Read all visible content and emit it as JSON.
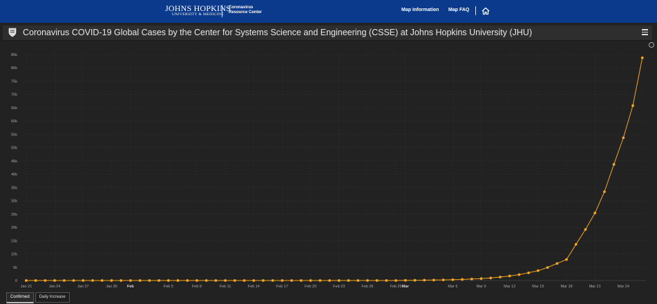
{
  "header": {
    "brand_name": "JOHNS HOPKINS",
    "brand_sub": "UNIVERSITY & MEDICINE",
    "resource_line1": "Coronavirus",
    "resource_line2": "Resource Center",
    "nav": [
      {
        "label": "Map Information"
      },
      {
        "label": "Map FAQ"
      }
    ]
  },
  "titlebar": {
    "title": "Coronavirus COVID-19 Global Cases by the Center for Systems Science and Engineering (CSSE) at Johns Hopkins University (JHU)"
  },
  "tabs": [
    {
      "label": "Confirmed",
      "active": true
    },
    {
      "label": "Daily Increase",
      "active": false
    }
  ],
  "colors": {
    "header_bg": "#0b3a8c",
    "chart_bg": "#222222",
    "series": "#f5a623"
  },
  "chart_data": {
    "type": "line",
    "title": "",
    "xlabel": "",
    "ylabel": "",
    "ylim": [
      0,
      85000
    ],
    "y_ticks": [
      "0",
      "5k",
      "10k",
      "15k",
      "20k",
      "25k",
      "30k",
      "35k",
      "40k",
      "45k",
      "50k",
      "55k",
      "60k",
      "65k",
      "70k",
      "75k",
      "80k",
      "85k"
    ],
    "y_tick_values": [
      0,
      5000,
      10000,
      15000,
      20000,
      25000,
      30000,
      35000,
      40000,
      45000,
      50000,
      55000,
      60000,
      65000,
      70000,
      75000,
      80000,
      85000
    ],
    "x_ticks": [
      {
        "label": "Jan 21",
        "index": 0,
        "bold": false
      },
      {
        "label": "Jan 24",
        "index": 3,
        "bold": false
      },
      {
        "label": "Jan 27",
        "index": 6,
        "bold": false
      },
      {
        "label": "Jan 30",
        "index": 9,
        "bold": false
      },
      {
        "label": "Feb",
        "index": 11,
        "bold": true
      },
      {
        "label": "Feb 5",
        "index": 15,
        "bold": false
      },
      {
        "label": "Feb 8",
        "index": 18,
        "bold": false
      },
      {
        "label": "Feb 11",
        "index": 21,
        "bold": false
      },
      {
        "label": "Feb 14",
        "index": 24,
        "bold": false
      },
      {
        "label": "Feb 17",
        "index": 27,
        "bold": false
      },
      {
        "label": "Feb 20",
        "index": 30,
        "bold": false
      },
      {
        "label": "Feb 23",
        "index": 33,
        "bold": false
      },
      {
        "label": "Feb 26",
        "index": 36,
        "bold": false
      },
      {
        "label": "Feb 29",
        "index": 39,
        "bold": false
      },
      {
        "label": "Mar",
        "index": 40,
        "bold": true
      },
      {
        "label": "Mar 6",
        "index": 45,
        "bold": false
      },
      {
        "label": "Mar 9",
        "index": 48,
        "bold": false
      },
      {
        "label": "Mar 12",
        "index": 51,
        "bold": false
      },
      {
        "label": "Mar 15",
        "index": 54,
        "bold": false
      },
      {
        "label": "Mar 18",
        "index": 57,
        "bold": false
      },
      {
        "label": "Mar 21",
        "index": 60,
        "bold": false
      },
      {
        "label": "Mar 24",
        "index": 63,
        "bold": false
      }
    ],
    "x_start": "Jan 21",
    "series": [
      {
        "values": [
          0,
          0,
          0,
          0,
          0,
          0,
          0,
          0,
          0,
          0,
          0,
          0,
          0,
          0,
          0,
          0,
          0,
          0,
          0,
          0,
          0,
          0,
          0,
          0,
          0,
          0,
          0,
          0,
          0,
          0,
          0,
          0,
          0,
          0,
          0,
          0,
          0,
          0,
          0,
          0,
          50,
          80,
          120,
          170,
          230,
          300,
          400,
          550,
          700,
          950,
          1300,
          1700,
          2200,
          2900,
          3700,
          4900,
          6400,
          7900,
          13600,
          19200,
          25400,
          33400,
          43700,
          53700,
          65800,
          83800
        ]
      }
    ],
    "grid": true,
    "legend": "none"
  }
}
